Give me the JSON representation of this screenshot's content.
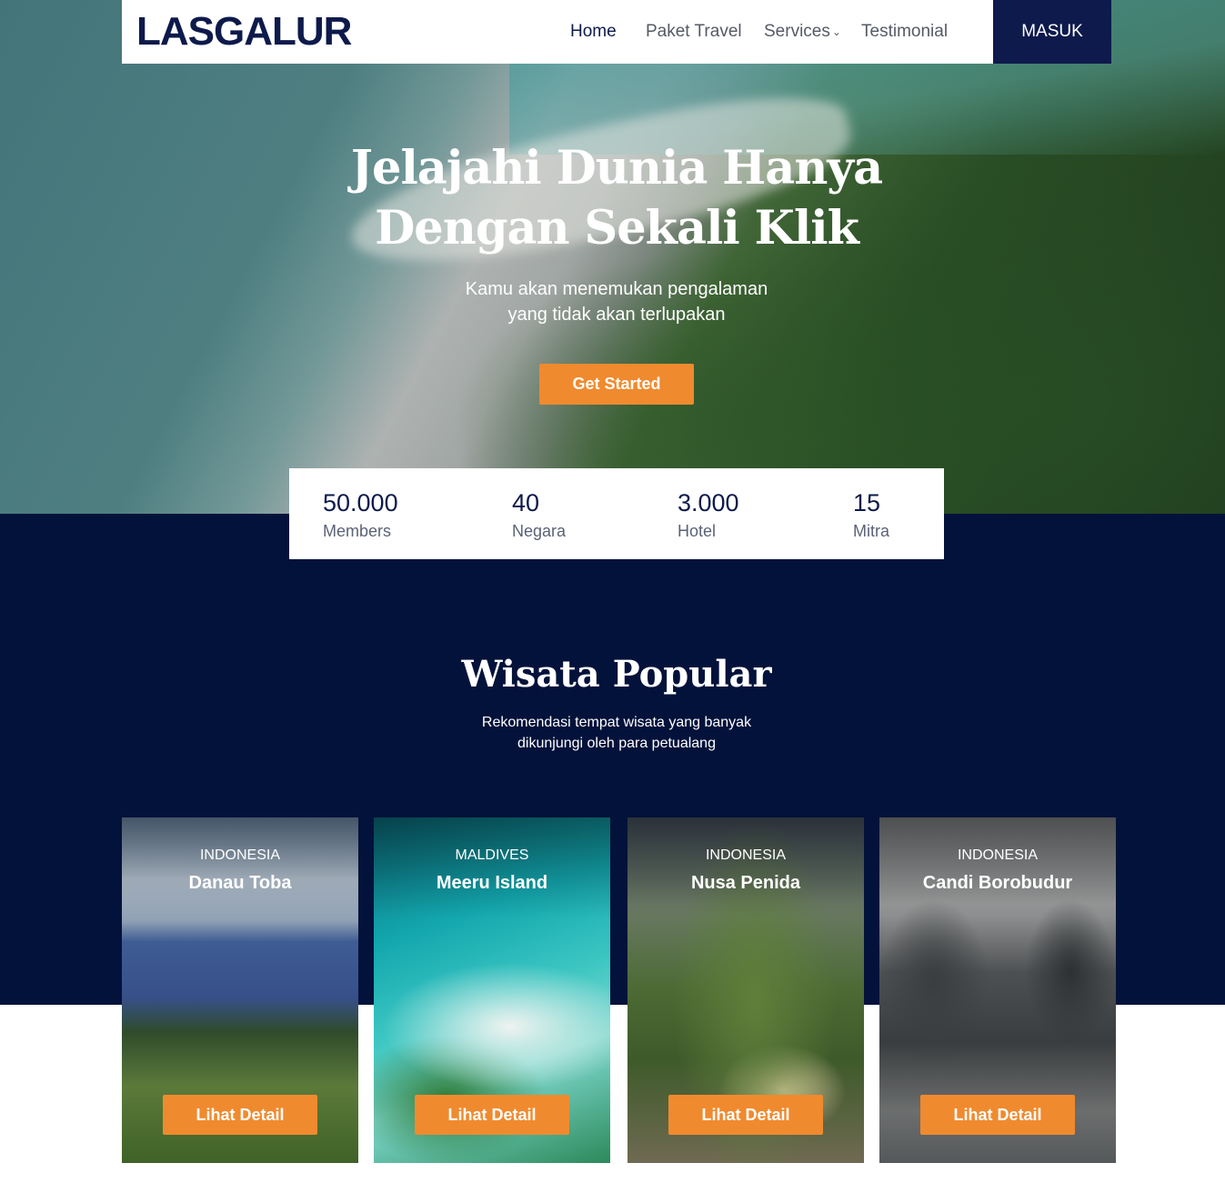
{
  "header": {
    "logo": "LASGALUR",
    "nav": [
      {
        "label": "Home",
        "active": true
      },
      {
        "label": "Paket Travel",
        "active": false
      },
      {
        "label": "Services",
        "active": false
      },
      {
        "label": "Testimonial",
        "active": false
      }
    ],
    "login_label": "MASUK"
  },
  "hero": {
    "title_line1": "Jelajahi Dunia Hanya",
    "title_line2": "Dengan Sekali Klik",
    "subtitle_line1": "Kamu akan menemukan pengalaman",
    "subtitle_line2": "yang tidak akan terlupakan",
    "cta_label": "Get Started"
  },
  "stats": [
    {
      "number": "50.000",
      "label": "Members"
    },
    {
      "number": "40",
      "label": "Negara"
    },
    {
      "number": "3.000",
      "label": "Hotel"
    },
    {
      "number": "15",
      "label": "Mitra"
    }
  ],
  "popular": {
    "title": "Wisata Popular",
    "subtitle_line1": "Rekomendasi tempat wisata yang banyak",
    "subtitle_line2": "dikunjungi oleh para petualang",
    "cards": [
      {
        "country": "INDONESIA",
        "name": "Danau Toba",
        "button": "Lihat Detail"
      },
      {
        "country": "MALDIVES",
        "name": "Meeru Island",
        "button": "Lihat Detail"
      },
      {
        "country": "INDONESIA",
        "name": "Nusa Penida",
        "button": "Lihat Detail"
      },
      {
        "country": "INDONESIA",
        "name": "Candi Borobudur",
        "button": "Lihat Detail"
      }
    ]
  },
  "colors": {
    "navy": "#0d1a4b",
    "dark_section": "#03123a",
    "accent_orange": "#f08a2e"
  },
  "icons": {
    "services_dropdown": "chevron-down-icon"
  }
}
